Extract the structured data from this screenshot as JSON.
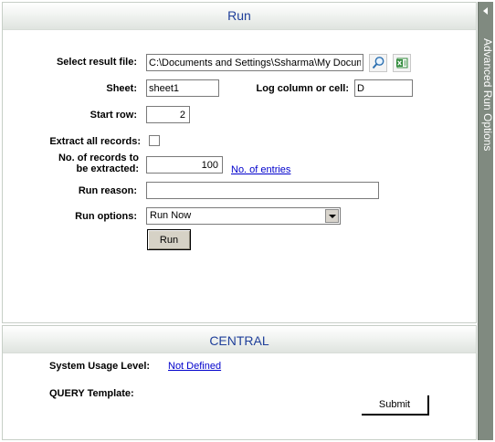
{
  "run": {
    "title": "Run",
    "select_result_file_label": "Select result file:",
    "result_file_value": "C:\\Documents and Settings\\Ssharma\\My Documents",
    "sheet_label": "Sheet:",
    "sheet_value": "sheet1",
    "log_column_label": "Log column or cell:",
    "log_column_value": "D",
    "start_row_label": "Start row:",
    "start_row_value": "2",
    "extract_all_label": "Extract all records:",
    "extract_all_checked": false,
    "records_count_label_line1": "No. of records to",
    "records_count_label_line2": "be extracted:",
    "records_count_value": "100",
    "no_of_entries_link": "No. of entries",
    "run_reason_label": "Run reason:",
    "run_reason_value": "",
    "run_options_label": "Run options:",
    "run_options_selected": "Run Now",
    "run_button": "Run"
  },
  "central": {
    "title": "CENTRAL",
    "system_usage_label": "System Usage Level:",
    "system_usage_link": "Not Defined",
    "query_template_label": "QUERY Template:",
    "submit_button": "Submit"
  },
  "side_tab": {
    "label": "Advanced Run Options"
  },
  "icons": {
    "search": "magnifier-icon",
    "excel": "excel-icon"
  }
}
